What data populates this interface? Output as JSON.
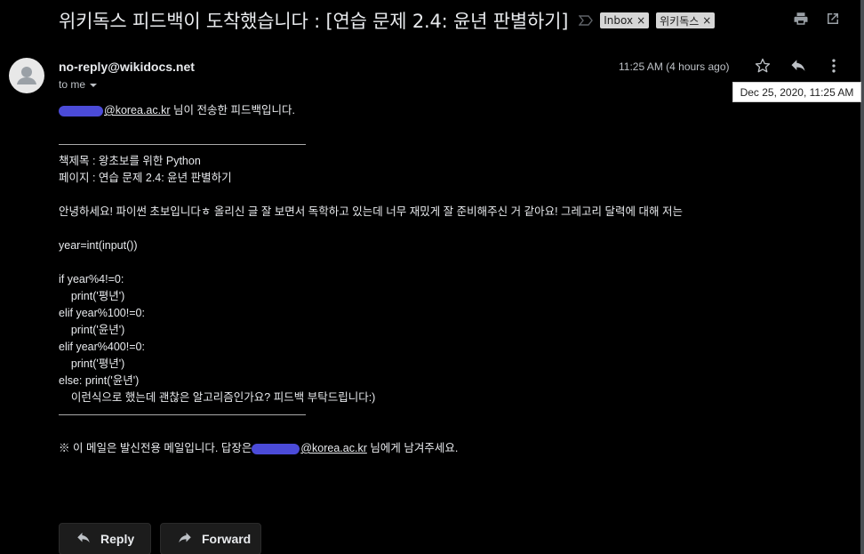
{
  "header": {
    "subject": "위키독스 피드백이 도착했습니다 : [연습 문제 2.4: 윤년 판별하기]",
    "labels": [
      {
        "text": "Inbox"
      },
      {
        "text": "위키독스"
      }
    ],
    "label_close": "×"
  },
  "message": {
    "sender": "no-reply@wikidocs.net",
    "to": "to me",
    "time": "11:25 AM (4 hours ago)",
    "tooltip": "Dec 25, 2020, 11:25 AM",
    "body": {
      "intro_email": "@korea.ac.kr",
      "intro_rest": " 님이 전송한 피드백입니다.",
      "book": "책제목 : 왕초보를 위한 Python",
      "page": "페이지 : 연습 문제 2.4: 윤년 판별하기",
      "greeting": "안녕하세요! 파이썬 초보입니다ㅎ 올리신 글 잘 보면서 독학하고 있는데 너무 재밌게 잘 준비해주신 거 같아요! 그레고리 달력에 대해 저는",
      "code": [
        "year=int(input())",
        "",
        "if year%4!=0:",
        "    print('평년')",
        "elif year%100!=0:",
        "    print('윤년')",
        "elif year%400!=0:",
        "    print('평년')",
        "else: print('윤년')",
        "    이런식으로 했는데 괜찮은 알고리즘인가요? 피드백 부탁드립니다:)"
      ],
      "notice_pre": "※ 이 메일은 발신전용 메일입니다. 답장은",
      "notice_email": "@korea.ac.kr",
      "notice_post": " 님에게 남겨주세요."
    }
  },
  "buttons": {
    "reply": "Reply",
    "forward": "Forward"
  },
  "colors": {
    "background": "#000000",
    "redaction": "#4b4bd8",
    "label_chip": "#d6d6d6"
  }
}
